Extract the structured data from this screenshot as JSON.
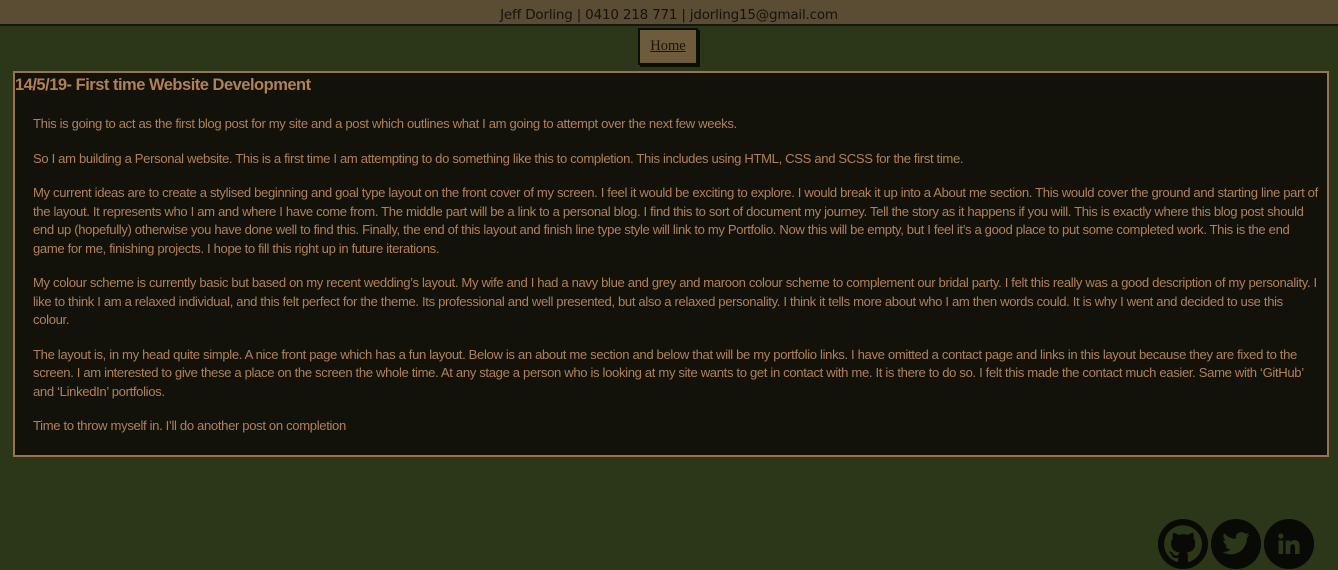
{
  "header": {
    "contact": "Jeff Dorling | 0410 218 771 | jdorling15@gmail.com"
  },
  "nav": {
    "home_label": "Home"
  },
  "post": {
    "title": "14/5/19- First time Website Development",
    "paragraphs": [
      "This is going to act as the first blog post for my site and a post which outlines what I am going to attempt over the next few weeks.",
      "So I am building a Personal website. This is a first time I am attempting to do something like this to completion. This includes using HTML, CSS and SCSS for the first time.",
      "My current ideas are to create a stylised beginning and goal type layout on the front cover of my screen. I feel it would be exciting to explore. I would break it up into a About me section. This would cover the ground and starting line part of the layout. It represents who I am and where I have come from. The middle part will be a link to a personal blog. I find this to sort of document my journey. Tell the story as it happens if you will. This is exactly where this blog post should end up (hopefully) otherwise you have done well to find this. Finally, the end of this layout and finish line type style will link to my Portfolio. Now this will be empty, but I feel it’s a good place to put some completed work. This is the end game for me, finishing projects. I hope to fill this right up in future iterations.",
      "My colour scheme is currently basic but based on my recent wedding’s layout. My wife and I had a navy blue and grey and maroon colour scheme to complement our bridal party. I felt this really was a good description of my personality. I like to think I am a relaxed individual, and this felt perfect for the theme. Its professional and well presented, but also a relaxed personality. I think it tells more about who I am then words could. It is why I went and decided to use this colour.",
      "The layout is, in my head quite simple. A nice front page which has a fun layout. Below is an about me section and below that will be my portfolio links. I have omitted a contact page and links in this layout because they are fixed to the screen. I am interested to give these a place on the screen the whole time. At any stage a person who is looking at my site wants to get in contact with me. It is there to do so. I felt this made the contact much easier. Same with ‘GitHub’ and ‘LinkedIn’ portfolios.",
      "Time to throw myself in. I’ll do another post on completion"
    ]
  },
  "socials": [
    {
      "icon": "github-icon"
    },
    {
      "icon": "twitter-icon"
    },
    {
      "icon": "linkedin-icon"
    }
  ],
  "colors": {
    "background": "#2c3619",
    "header": "#5b4c34",
    "post_background": "#12120a",
    "post_border": "#987254",
    "text": "#b08058",
    "title": "#b27f57"
  }
}
